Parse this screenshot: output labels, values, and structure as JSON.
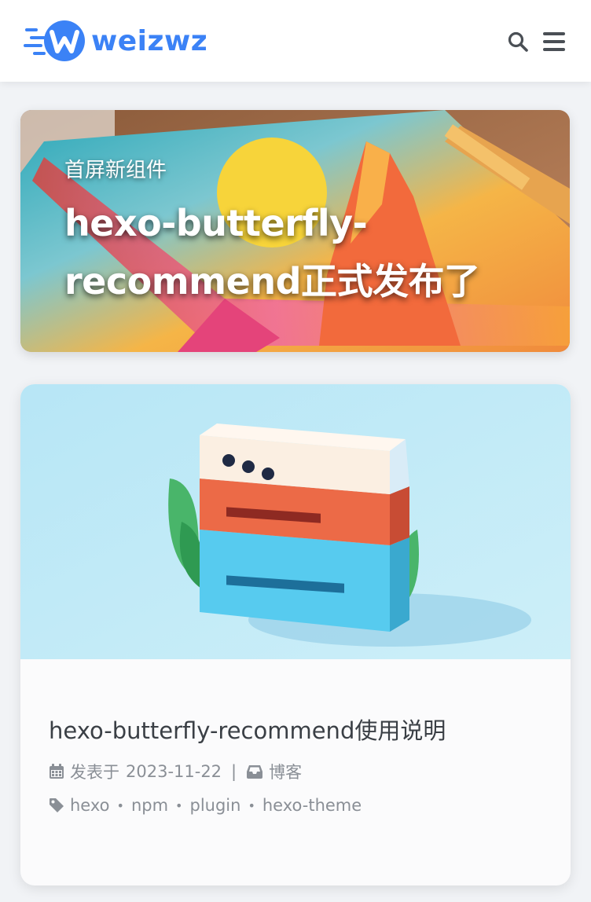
{
  "site": {
    "name": "weizwz"
  },
  "header": {
    "search_icon": "search-icon",
    "menu_icon": "bars-icon"
  },
  "hero": {
    "kicker": "首屏新组件",
    "title_line1": "hexo-butterfly-",
    "title_line2": "recommend正式发布了"
  },
  "post": {
    "title": "hexo-butterfly-recommend使用说明",
    "published_label": "发表于",
    "published_date": "2023-11-22",
    "separator": "|",
    "category": "博客",
    "tags": [
      "hexo",
      "npm",
      "plugin",
      "hexo-theme"
    ]
  },
  "colors": {
    "brand": "#3b82f6",
    "page_bg": "#f1f3f6",
    "meta_text": "#8a8f96"
  }
}
